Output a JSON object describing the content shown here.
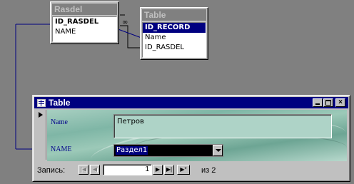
{
  "relationship": {
    "table1": {
      "title": "Rasdel",
      "fields": [
        "ID_RASDEL",
        "NAME"
      ]
    },
    "table2": {
      "title": "Table",
      "fields": [
        "ID_RECORD",
        "Name",
        "ID_RASDEL"
      ]
    },
    "link_symbol": "∞"
  },
  "form": {
    "window_title": "Table",
    "close_glyph": "×",
    "name_label": "Name",
    "name_value": "Петров",
    "rasdel_label": "NAME",
    "rasdel_value": "Раздел1",
    "nav": {
      "label": "Запись:",
      "first": "|◀",
      "prev": "◀",
      "current": "1",
      "next": "▶",
      "last": "▶|",
      "new": "▶*",
      "of_label": "из",
      "total": "2"
    }
  },
  "colors": {
    "background": "#808080",
    "titlebar": "#000080",
    "label_text": "#00008b",
    "callout_line": "#000080"
  }
}
